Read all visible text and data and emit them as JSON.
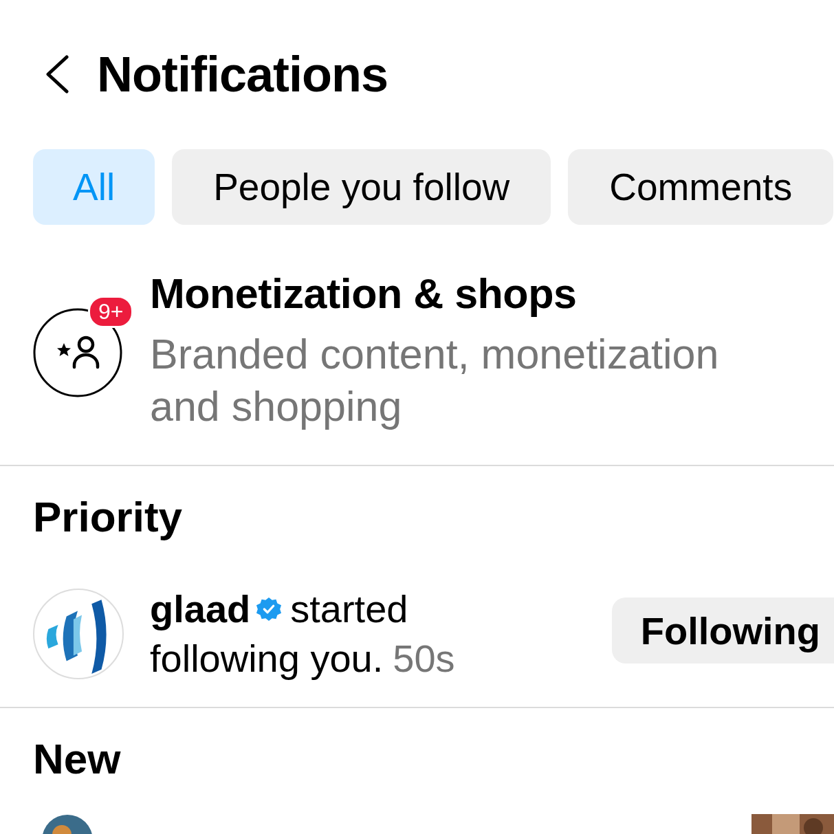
{
  "header": {
    "title": "Notifications"
  },
  "tabs": [
    {
      "label": "All",
      "selected": true
    },
    {
      "label": "People you follow",
      "selected": false
    },
    {
      "label": "Comments",
      "selected": false
    }
  ],
  "summary": {
    "title": "Monetization & shops",
    "subtitle": "Branded content, monetization and shopping",
    "badge": "9+"
  },
  "sections": [
    {
      "heading": "Priority",
      "items": [
        {
          "kind": "follow",
          "user": "glaad",
          "verified": true,
          "lines": [
            "started",
            "following you."
          ],
          "time": "50s",
          "button": "Following"
        }
      ]
    },
    {
      "heading": "New",
      "items": [
        {
          "kind": "partial"
        }
      ]
    }
  ]
}
